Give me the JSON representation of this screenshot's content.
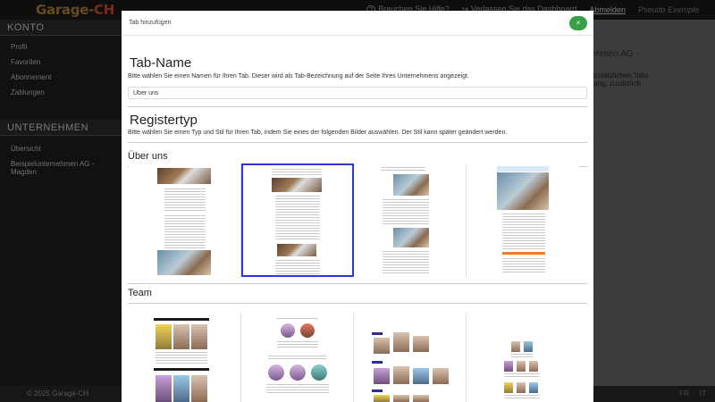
{
  "app": {
    "logo_main": "Garage-",
    "logo_accent": "CH"
  },
  "topnav": {
    "help_label": "Brauchen Sie Hilfe?",
    "dashboard_label": "Verlassen Sie das Dashboard",
    "logout_label": "Abmelden",
    "user_label": "Pseudo Exemple"
  },
  "sidebar": {
    "konto_title": "KONTO",
    "konto_items": [
      "Profil",
      "Favoriten",
      "Abonnement",
      "Zahlungen"
    ],
    "unternehmen_title": "UNTERNEHMEN",
    "unternehmen_items": [
      "Übersicht",
      "Beispielunternehmen AG - Magden"
    ]
  },
  "background_panel": {
    "title": "nehmen AG -",
    "line1": "2 zusätzlichen Tabs",
    "line2": "ssung, zusätzlich"
  },
  "footer": {
    "copyright": "© 2025 Garage-CH",
    "lang_fr": "FR",
    "lang_it": "IT"
  },
  "modal": {
    "title": "Tab hinzufügen",
    "close_label": "×",
    "tab_name_heading": "Tab-Name",
    "tab_name_hint": "Bitte wählen Sie einen Namen für Ihren Tab. Dieser wird als Tab-Bezeichnung auf der Seite Ihres Unternehmens angezeigt.",
    "tab_name_value": "Über uns",
    "register_heading": "Registertyp",
    "register_hint": "Bitte wählen Sie einen Typ und Stil für Ihren Tab, indem Sie eines der folgenden Bilder auswählen. Der Stil kann später geändert werden.",
    "group_about": "Über uns",
    "group_team": "Team"
  },
  "colors": {
    "accent_green": "#3aa047",
    "selection_blue": "#2d38d6",
    "logo_gold": "#b8863a",
    "logo_red": "#e04a2f"
  }
}
